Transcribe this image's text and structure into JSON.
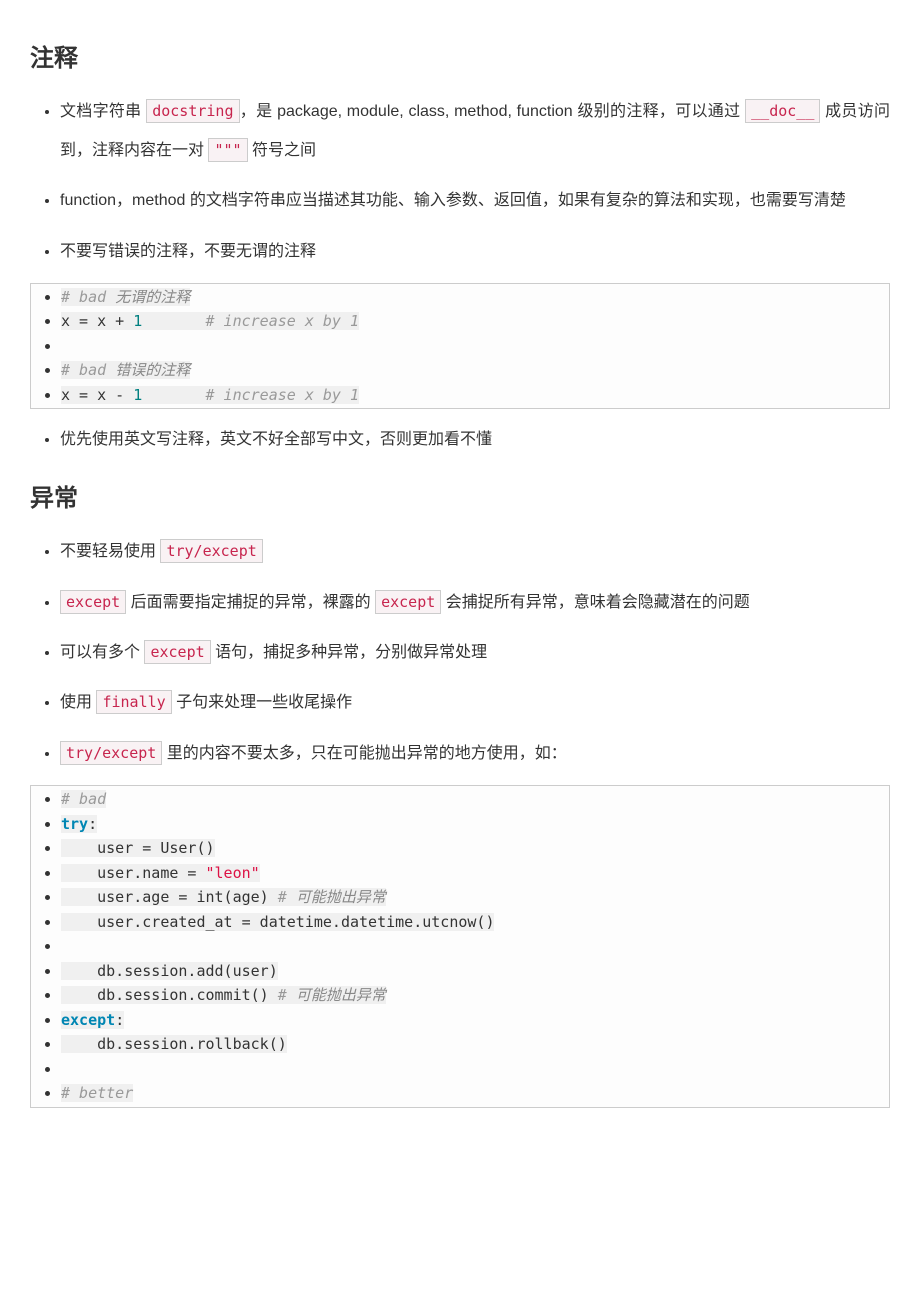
{
  "sections": {
    "comments": {
      "heading": "注释",
      "bullets": [
        {
          "pre1": "文档字符串 ",
          "code1": "docstring",
          "mid1": "，是 package, module, class, method, function 级别的注释，可以通过 ",
          "code2": "__doc__",
          "mid2": " 成员访问到，注释内容在一对 ",
          "code3": "\"\"\"",
          "post": " 符号之间"
        },
        {
          "text": "function，method 的文档字符串应当描述其功能、输入参数、返回值，如果有复杂的算法和实现，也需要写清楚"
        },
        {
          "text": "不要写错误的注释，不要无谓的注释"
        }
      ],
      "code": [
        "# bad 无谓的注释",
        "x = x + 1       # increase x by 1",
        "",
        "# bad 错误的注释",
        "x = x - 1       # increase x by 1"
      ],
      "after_code_bullet": "优先使用英文写注释，英文不好全部写中文，否则更加看不懂"
    },
    "exceptions": {
      "heading": "异常",
      "bullets": [
        {
          "pre1": "不要轻易使用 ",
          "code1": "try/except"
        },
        {
          "code1": "except",
          "mid1": " 后面需要指定捕捉的异常，裸露的 ",
          "code2": "except",
          "post": " 会捕捉所有异常，意味着会隐藏潜在的问题"
        },
        {
          "pre1": "可以有多个 ",
          "code1": "except",
          "post": " 语句，捕捉多种异常，分别做异常处理"
        },
        {
          "pre1": "使用 ",
          "code1": "finally",
          "post": " 子句来处理一些收尾操作"
        },
        {
          "code1": "try/except",
          "post": " 里的内容不要太多，只在可能抛出异常的地方使用，如："
        }
      ],
      "code": [
        "# bad",
        "try:",
        "    user = User()",
        "    user.name = \"leon\"",
        "    user.age = int(age) # 可能抛出异常",
        "    user.created_at = datetime.datetime.utcnow()",
        "",
        "    db.session.add(user)",
        "    db.session.commit() # 可能抛出异常",
        "except:",
        "    db.session.rollback()",
        "",
        "# better"
      ]
    }
  }
}
